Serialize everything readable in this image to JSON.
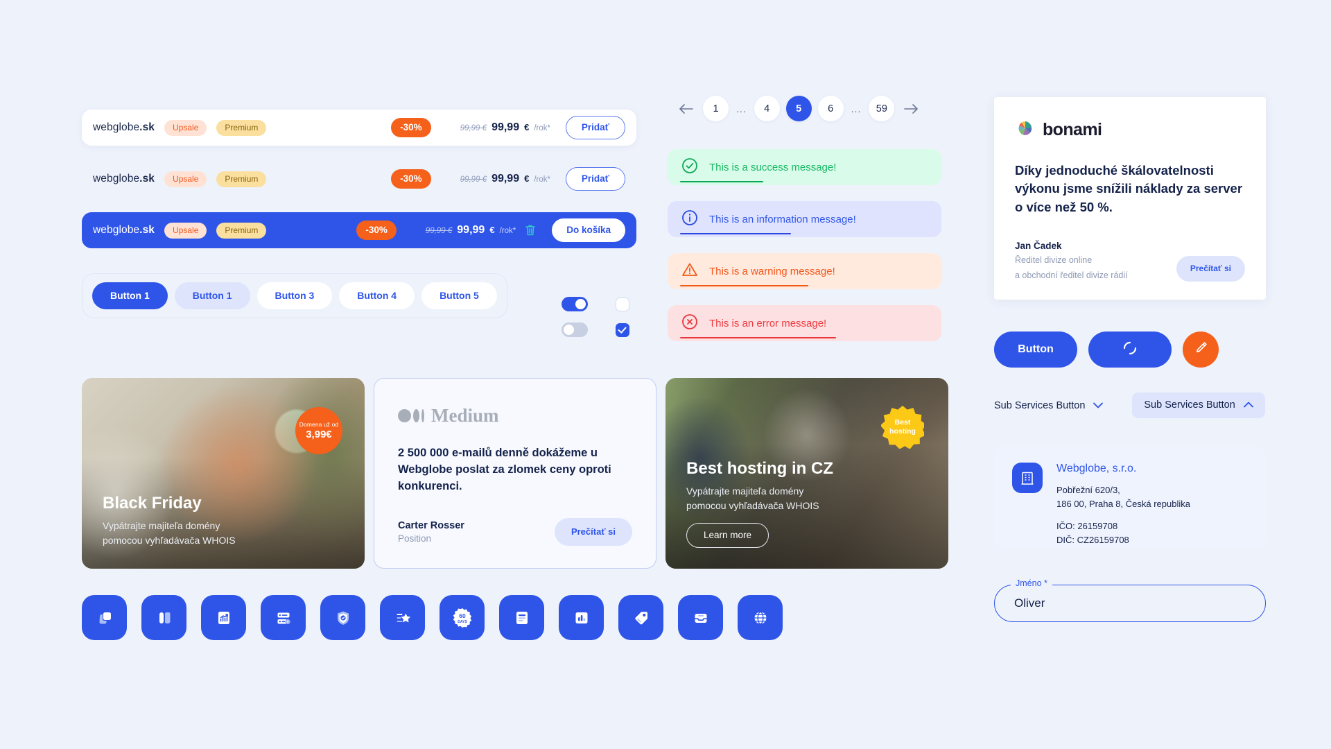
{
  "colors": {
    "brand_blue": "#2f55e8",
    "orange": "#f5601a",
    "page_bg": "#eef2fb",
    "success": "#18b865",
    "warning": "#f4571d",
    "error": "#ef3a41",
    "yellow": "#fcc916"
  },
  "domain_rows": [
    {
      "name_main": "webglobe",
      "name_tld": ".sk",
      "tags": [
        "Upsale",
        "Premium"
      ],
      "discount": "-30%",
      "price_old": "99,99 €",
      "price_new": "99,99",
      "currency": "€",
      "period": "/rok*",
      "action_label": "Pridať",
      "state": "white"
    },
    {
      "name_main": "webglobe",
      "name_tld": ".sk",
      "tags": [
        "Upsale",
        "Premium"
      ],
      "discount": "-30%",
      "price_old": "99,99 €",
      "price_new": "99,99",
      "currency": "€",
      "period": "/rok*",
      "action_label": "Pridať",
      "state": "ghost"
    },
    {
      "name_main": "webglobe",
      "name_tld": ".sk",
      "tags": [
        "Upsale",
        "Premium"
      ],
      "discount": "-30%",
      "price_old": "99,99 €",
      "price_new": "99,99",
      "currency": "€",
      "period": "/rok*",
      "action_label": "Do košíka",
      "state": "active"
    }
  ],
  "button_group": [
    {
      "label": "Button 1",
      "variant": "primary"
    },
    {
      "label": "Button 1",
      "variant": "soft"
    },
    {
      "label": "Button 3",
      "variant": "white"
    },
    {
      "label": "Button 4",
      "variant": "white"
    },
    {
      "label": "Button 5",
      "variant": "white"
    }
  ],
  "toggles": {
    "switch_on": "on",
    "switch_off": "off",
    "checkbox_unchecked": "unchecked",
    "checkbox_checked": "checked"
  },
  "pagination": {
    "prev_icon": "arrow-left-icon",
    "next_icon": "arrow-right-icon",
    "items": [
      "1",
      "...",
      "4",
      "5",
      "6",
      "...",
      "59"
    ],
    "current": "5"
  },
  "alerts": [
    {
      "type": "success",
      "icon": "check-circle-icon",
      "message": "This is a success message!"
    },
    {
      "type": "info",
      "icon": "info-circle-icon",
      "message": "This is an information message!"
    },
    {
      "type": "warning",
      "icon": "warning-triangle-icon",
      "message": "This is a warning message!"
    },
    {
      "type": "error",
      "icon": "error-circle-icon",
      "message": "This is an error message!"
    }
  ],
  "cards": {
    "black_friday": {
      "title": "Black Friday",
      "subtitle_line1": "Vypátrajte majiteľa domény",
      "subtitle_line2": "pomocou vyhľadávača WHOIS",
      "badge_line1": "Domena už od",
      "badge_line2": "3,99€"
    },
    "medium": {
      "logo_word": "Medium",
      "quote": "2 500 000 e-mailů denně dokážeme u Webglobe poslat za zlomek ceny oproti konkurenci.",
      "author": "Carter Rosser",
      "position": "Position",
      "button": "Prečítať si"
    },
    "best_hosting": {
      "title": "Best hosting in CZ",
      "subtitle_line1": "Vypátrajte majiteľa domény",
      "subtitle_line2": "pomocou vyhľadávača WHOIS",
      "button": "Learn more",
      "badge_line1": "Best",
      "badge_line2": "hosting"
    }
  },
  "icon_tiles": [
    "copy-layers-icon",
    "palette-icon",
    "growth-chart-icon",
    "server-power-icon",
    "shield-check-icon",
    "star-badge-icon",
    "sixty-days-icon",
    "document-lines-icon",
    "bar-chart-icon",
    "price-tag-icon",
    "inbox-icon",
    "globe-icon"
  ],
  "icon_tiles_text": {
    "sixty_days_num": "60",
    "sixty_days_label": "DAYS"
  },
  "bonami": {
    "logo_word": "bonami",
    "quote": "Díky jednoduché škálovatelnosti výkonu jsme snížili náklady za server o více než 50 %.",
    "author": "Jan Čadek",
    "role_line1": "Ředitel divize online",
    "role_line2": "a obchodní ředitel divize rádií",
    "button": "Prečítať si"
  },
  "right_buttons": {
    "primary_label": "Button",
    "spinner_icon": "loading-spinner-icon",
    "fab_icon": "pencil-edit-icon"
  },
  "sub_services": [
    {
      "label": "Sub Services Button",
      "chevron": "chevron-down-icon",
      "style": "plain"
    },
    {
      "label": "Sub Services Button",
      "chevron": "chevron-up-icon",
      "style": "filled"
    }
  ],
  "company": {
    "icon": "building-icon",
    "name": "Webglobe, s.r.o.",
    "address_line1": "Pobřežní 620/3,",
    "address_line2": "186 00, Praha 8, Česká republika",
    "ico": "IČO: 26159708",
    "dic": "DIČ: CZ26159708"
  },
  "name_field": {
    "label": "Jméno *",
    "value": "Oliver",
    "placeholder": "Jméno"
  }
}
